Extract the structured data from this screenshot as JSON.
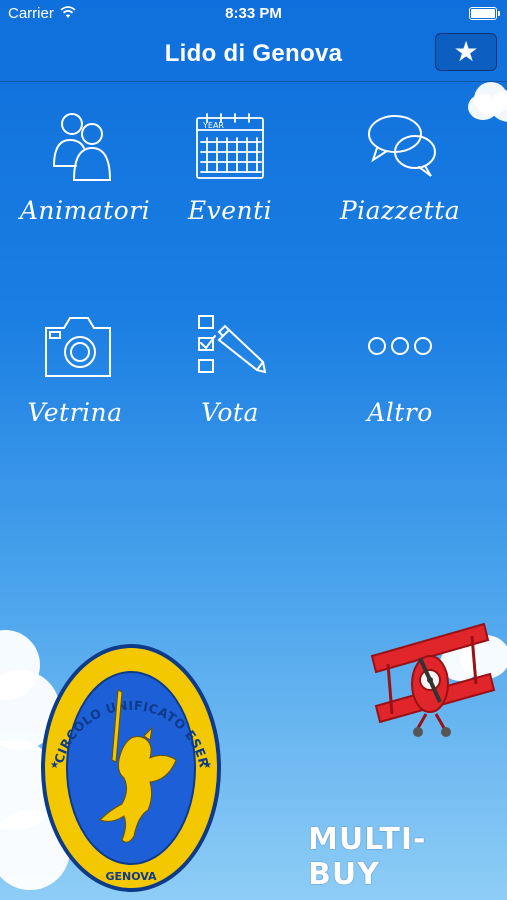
{
  "status_bar": {
    "carrier": "Carrier",
    "time": "8:33 PM"
  },
  "nav": {
    "title": "Lido di Genova",
    "favorite_icon": "star-icon"
  },
  "tiles": [
    {
      "label": "Animatori",
      "icon": "people-icon"
    },
    {
      "label": "Eventi",
      "icon": "calendar-icon",
      "icon_text": "YEAR"
    },
    {
      "label": "Piazzetta",
      "icon": "chat-bubbles-icon"
    },
    {
      "label": "Vetrina",
      "icon": "camera-icon"
    },
    {
      "label": "Vota",
      "icon": "checklist-pencil-icon"
    },
    {
      "label": "Altro",
      "icon": "more-dots-icon"
    }
  ],
  "emblem": {
    "top_text": "CIRCOLO UNIFICATO ESERCITO",
    "bottom_text": "GENOVA"
  },
  "brand": {
    "name": "MULTI-BUY"
  },
  "colors": {
    "sky_top": "#0f6fdc",
    "sky_bottom": "#8ecdf6",
    "emblem_yellow": "#f4c800",
    "emblem_blue": "#1d5fd6",
    "plane_red": "#e0262b"
  }
}
